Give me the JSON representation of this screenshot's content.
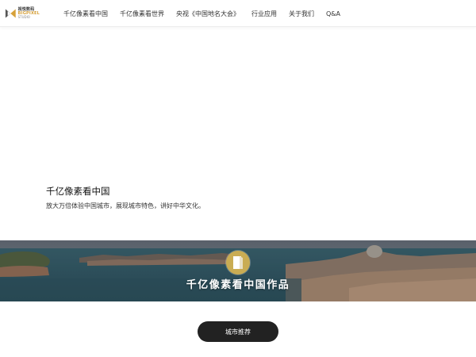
{
  "header": {
    "logo": {
      "line1": "视悦数码",
      "line2": "BIGPIXEL",
      "line3": "STUDIO"
    },
    "nav": [
      {
        "label": "千亿像素看中国"
      },
      {
        "label": "千亿像素看世界"
      },
      {
        "label": "央视《中国地名大会》"
      },
      {
        "label": "行业应用"
      },
      {
        "label": "关于我们"
      },
      {
        "label": "Q&A"
      }
    ]
  },
  "hero": {
    "title": "千亿像素看中国",
    "subtitle": "放大万倍体验中国城市，展现城市特色，讲好中华文化。"
  },
  "banner": {
    "title": "千亿像素看中国作品",
    "icon": "door-icon",
    "icon_color": "#c9ac53"
  },
  "cta": {
    "label": "城市推荐"
  },
  "colors": {
    "accent": "#d6a13a",
    "button_bg": "#222222"
  }
}
